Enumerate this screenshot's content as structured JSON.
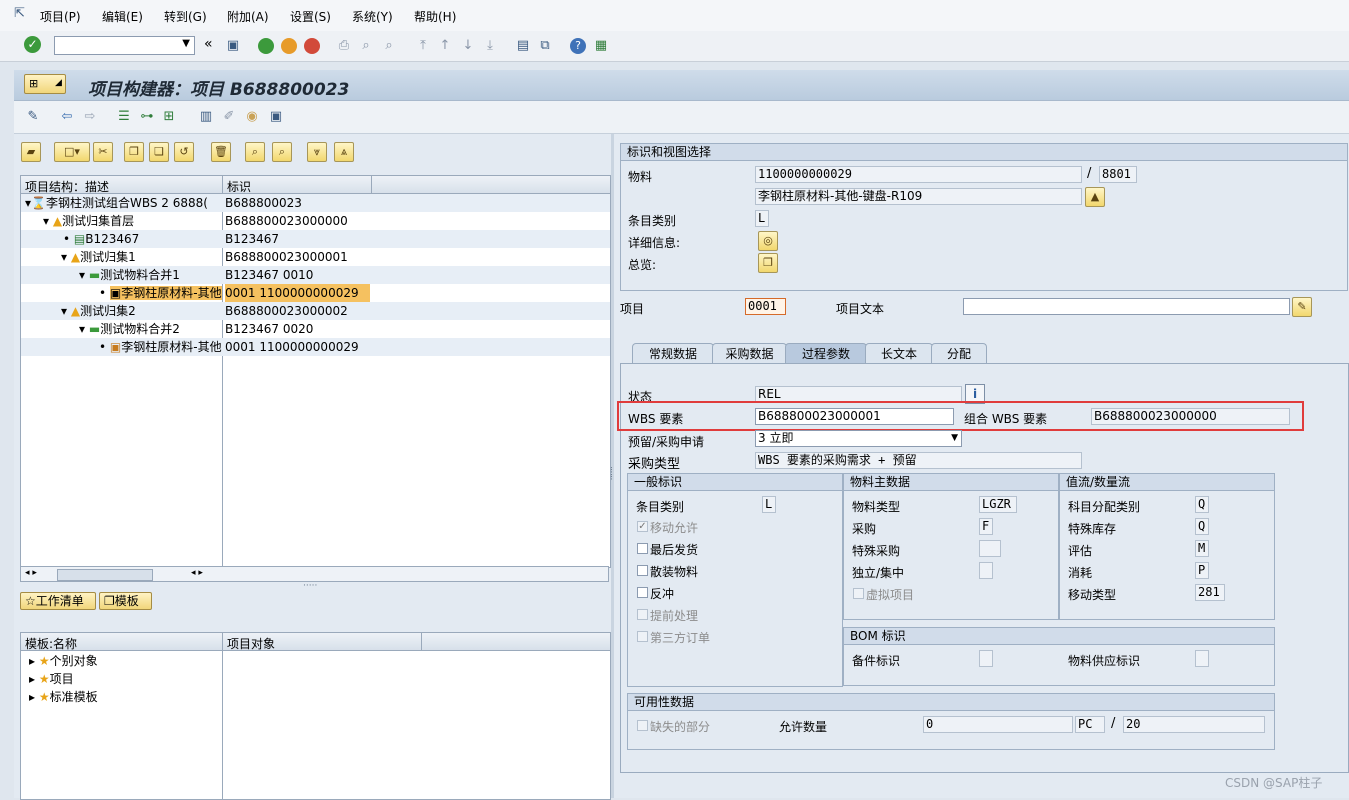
{
  "menu": [
    "项目(P)",
    "编辑(E)",
    "转到(G)",
    "附加(A)",
    "设置(S)",
    "系统(Y)",
    "帮助(H)"
  ],
  "header": {
    "title": "项目构建器：项目 B688800023"
  },
  "tree": {
    "col_desc": "项目结构：描述",
    "col_id": "标识",
    "rows": [
      {
        "desc": "李钢柱测试组合WBS 2  6888(",
        "id": "B688800023"
      },
      {
        "desc": "测试归集首层",
        "id": "B688800023000000"
      },
      {
        "desc": "B123467",
        "id": "B123467"
      },
      {
        "desc": "测试归集1",
        "id": "B688800023000001"
      },
      {
        "desc": "测试物料合并1",
        "id": "B123467 0010"
      },
      {
        "desc": "李钢柱原材料-其他",
        "id": "0001 1100000000029"
      },
      {
        "desc": "测试归集2",
        "id": "B688800023000002"
      },
      {
        "desc": "测试物料合并2",
        "id": "B123467 0020"
      },
      {
        "desc": "李钢柱原材料-其他",
        "id": "0001 1100000000029"
      }
    ]
  },
  "worklist": {
    "btn_worklist": "工作清单",
    "btn_template": "模板"
  },
  "templates": {
    "col_name": "模板:名称",
    "col_obj": "项目对象",
    "items": [
      "个别对象",
      "项目",
      "标准模板"
    ]
  },
  "ident": {
    "title": "标识和视图选择",
    "material_label": "物料",
    "material_value": "1100000000029",
    "plant_sep": "/",
    "plant_value": "8801",
    "material_desc": "李钢柱原材料-其他-键盘-R109",
    "item_cat_label": "条目类别",
    "item_cat_value": "L",
    "detail_label": "详细信息:",
    "overview_label": "总览:"
  },
  "item": {
    "label": "项目",
    "value": "0001",
    "text_label": "项目文本",
    "text_value": ""
  },
  "tabs": [
    "常规数据",
    "采购数据",
    "过程参数",
    "长文本",
    "分配"
  ],
  "proc": {
    "status_label": "状态",
    "status_value": "REL",
    "wbs_label": "WBS 要素",
    "wbs_value": "B688800023000001",
    "comb_label": "组合 WBS 要素",
    "comb_value": "B688800023000000",
    "resv_label": "预留/采购申请",
    "resv_value": "3 立即",
    "ptype_label": "采购类型",
    "ptype_value": "WBS 要素的采购需求 + 预留"
  },
  "general": {
    "title": "一般标识",
    "item_cat_label": "条目类别",
    "item_cat_value": "L",
    "cb_move": "移动允许",
    "cb_final": "最后发货",
    "cb_bulk": "散装物料",
    "cb_backflush": "反冲",
    "cb_early": "提前处理",
    "cb_third": "第三方订单"
  },
  "master": {
    "title": "物料主数据",
    "mtype_label": "物料类型",
    "mtype_value": "LGZR",
    "proc_label": "采购",
    "proc_value": "F",
    "spec_label": "特殊采购",
    "spec_value": "",
    "indep_label": "独立/集中",
    "indep_value": "",
    "phantom_label": "虚拟项目"
  },
  "valuation": {
    "title": "值流/数量流",
    "acct_label": "科目分配类别",
    "acct_value": "Q",
    "spstock_label": "特殊库存",
    "spstock_value": "Q",
    "valu_label": "评估",
    "valu_value": "M",
    "cons_label": "消耗",
    "cons_value": "P",
    "mvt_label": "移动类型",
    "mvt_value": "281"
  },
  "bom": {
    "title": "BOM 标识",
    "spare_label": "备件标识",
    "supply_label": "物料供应标识"
  },
  "avail": {
    "title": "可用性数据",
    "missing_label": "缺失的部分",
    "qty_label": "允许数量",
    "qty_value": "0",
    "unit_value": "PC",
    "sep": "/",
    "num_value": "20"
  },
  "watermark": "CSDN @SAP柱子"
}
